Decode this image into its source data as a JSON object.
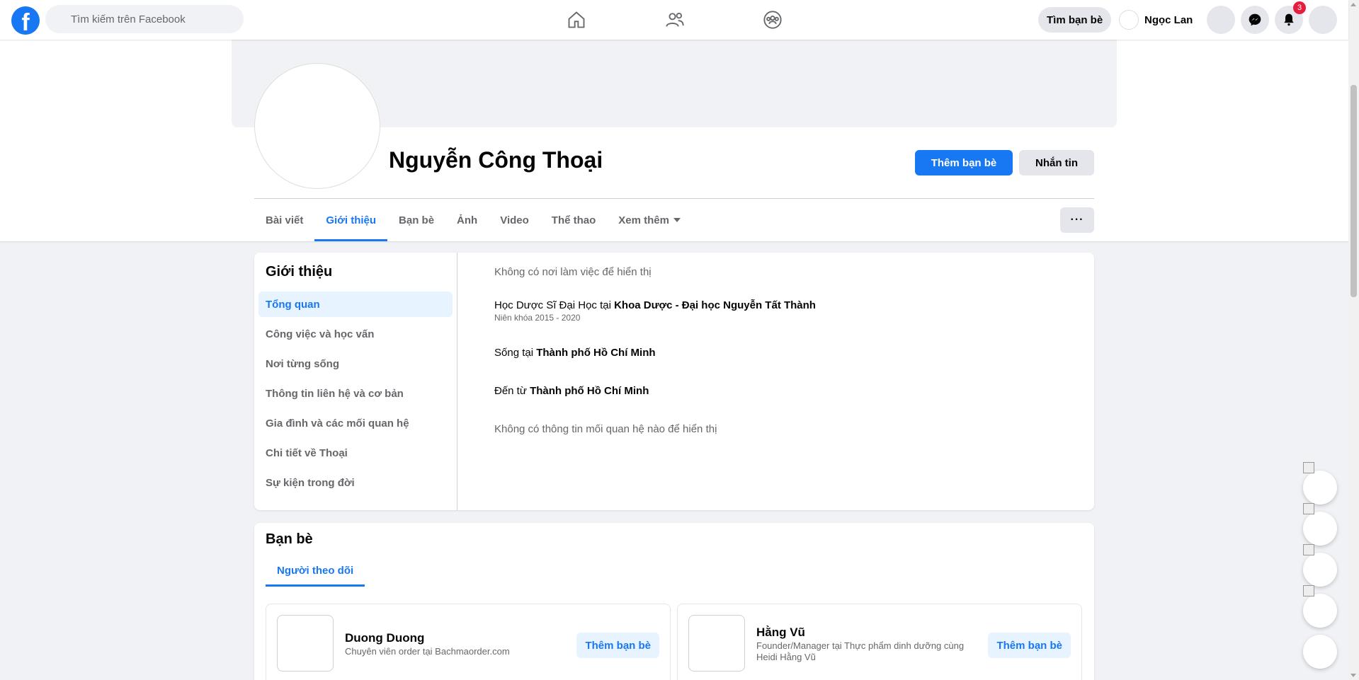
{
  "topbar": {
    "search_placeholder": "Tìm kiếm trên Facebook",
    "find_friends": "Tìm bạn bè",
    "user_name": "Ngọc Lan",
    "notification_count": "3"
  },
  "profile": {
    "name": "Nguyễn Công Thoại",
    "add_friend": "Thêm bạn bè",
    "message": "Nhắn tin",
    "more": "···"
  },
  "tabs": [
    {
      "label": "Bài viết"
    },
    {
      "label": "Giới thiệu"
    },
    {
      "label": "Bạn bè"
    },
    {
      "label": "Ảnh"
    },
    {
      "label": "Video"
    },
    {
      "label": "Thể thao"
    },
    {
      "label": "Xem thêm"
    }
  ],
  "about": {
    "title": "Giới thiệu",
    "nav": [
      {
        "label": "Tổng quan"
      },
      {
        "label": "Công việc và học vấn"
      },
      {
        "label": "Nơi từng sống"
      },
      {
        "label": "Thông tin liên hệ và cơ bản"
      },
      {
        "label": "Gia đình và các mối quan hệ"
      },
      {
        "label": "Chi tiết về Thoại"
      },
      {
        "label": "Sự kiện trong đời"
      }
    ],
    "no_work": "Không có nơi làm việc để hiển thị",
    "study_prefix": "Học Dược Sĩ Đại Học tại ",
    "study_school": "Khoa Dược - Đại học Nguyễn Tất Thành",
    "study_years": "Niên khóa 2015 - 2020",
    "lives_prefix": "Sống tại ",
    "lives_place": "Thành phố Hồ Chí Minh",
    "from_prefix": "Đến từ ",
    "from_place": "Thành phố Hồ Chí Minh",
    "no_relationship": "Không có thông tin mối quan hệ nào để hiển thị"
  },
  "friends": {
    "title": "Bạn bè",
    "tab": "Người theo dõi",
    "items": [
      {
        "name": "Duong Duong",
        "desc": "Chuyên viên order tại Bachmaorder.com",
        "action": "Thêm bạn bè"
      },
      {
        "name": "Hằng Vũ",
        "desc": "Founder/Manager tại Thực phẩm dinh dưỡng cùng Heidi Hằng Vũ",
        "action": "Thêm bạn bè"
      }
    ]
  }
}
